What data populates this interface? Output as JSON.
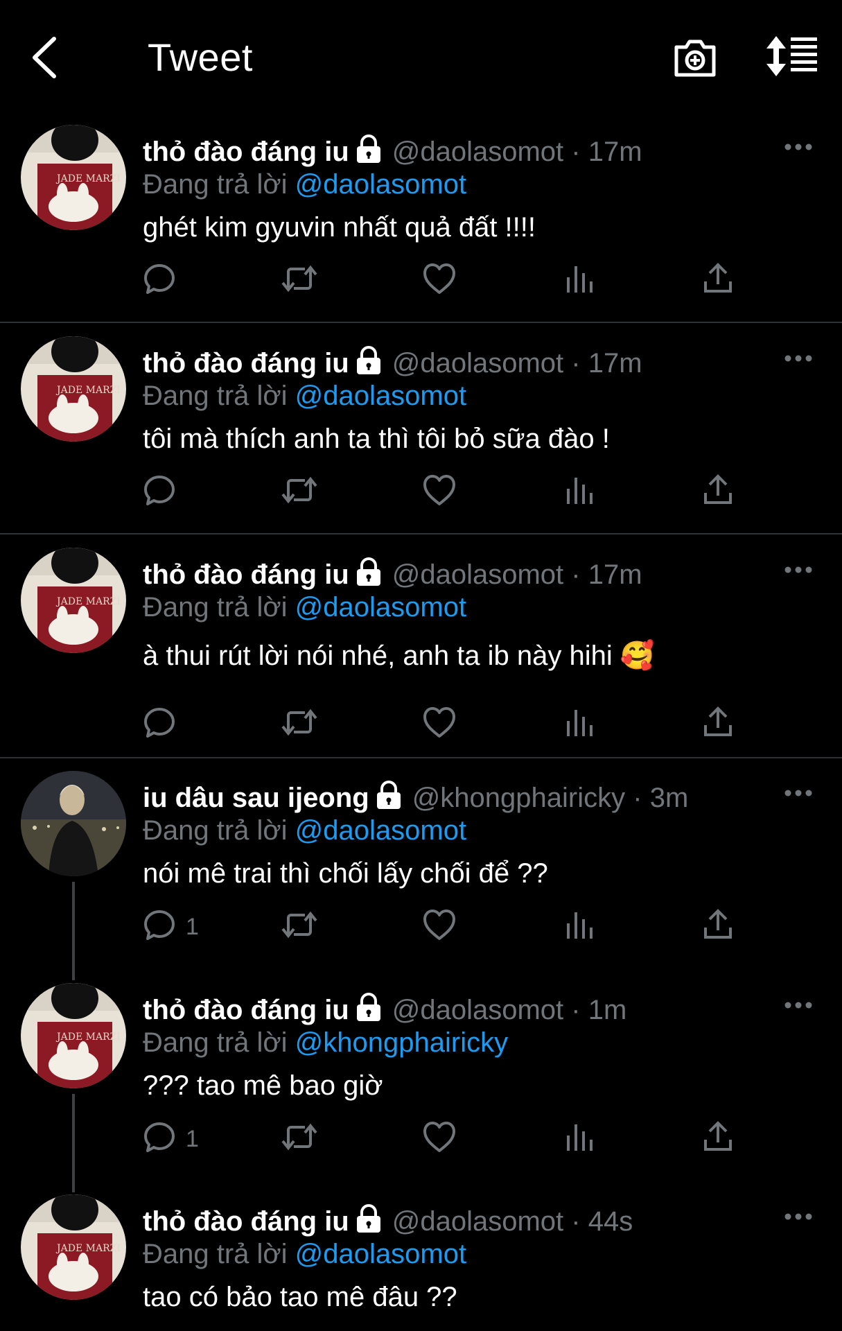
{
  "header": {
    "title": "Tweet",
    "back_icon": "chevron-left-icon",
    "camera_icon": "camera-plus-icon",
    "sort_icon": "sort-icon"
  },
  "colors": {
    "background": "#000000",
    "text": "#ffffff",
    "muted": "#71767b",
    "link": "#1d9bf0",
    "divider": "#2f3336"
  },
  "tweets": [
    {
      "name": "thỏ đào đáng iu",
      "handle": "@daolasomot",
      "dot": "·",
      "time": "17m",
      "reply_prefix": "Đang trả lời",
      "reply_to": "@daolasomot",
      "text": "ghét kim gyuvin nhất quả đất !!!!",
      "reply_count": ""
    },
    {
      "name": "thỏ đào đáng iu",
      "handle": "@daolasomot",
      "dot": "·",
      "time": "17m",
      "reply_prefix": "Đang trả lời",
      "reply_to": "@daolasomot",
      "text": "tôi mà thích anh ta thì tôi bỏ sữa đào !",
      "reply_count": ""
    },
    {
      "name": "thỏ đào đáng iu",
      "handle": "@daolasomot",
      "dot": "·",
      "time": "17m",
      "reply_prefix": "Đang trả lời",
      "reply_to": "@daolasomot",
      "text": "à thui rút lời nói nhé, anh ta ib này hihi 🥰",
      "reply_count": ""
    },
    {
      "name": "iu dâu sau ijeong",
      "handle": "@khongphairicky",
      "dot": "·",
      "time": "3m",
      "reply_prefix": "Đang trả lời",
      "reply_to": "@daolasomot",
      "text": "nói mê trai thì chối lấy chối để ??",
      "reply_count": "1"
    },
    {
      "name": "thỏ đào đáng iu",
      "handle": "@daolasomot",
      "dot": "·",
      "time": "1m",
      "reply_prefix": "Đang trả lời",
      "reply_to": "@khongphairicky",
      "text": "??? tao mê bao giờ",
      "reply_count": "1"
    },
    {
      "name": "thỏ đào đáng iu",
      "handle": "@daolasomot",
      "dot": "·",
      "time": "44s",
      "reply_prefix": "Đang trả lời",
      "reply_to": "@daolasomot",
      "text": "tao có bảo tao mê đâu ??",
      "reply_count": ""
    }
  ]
}
